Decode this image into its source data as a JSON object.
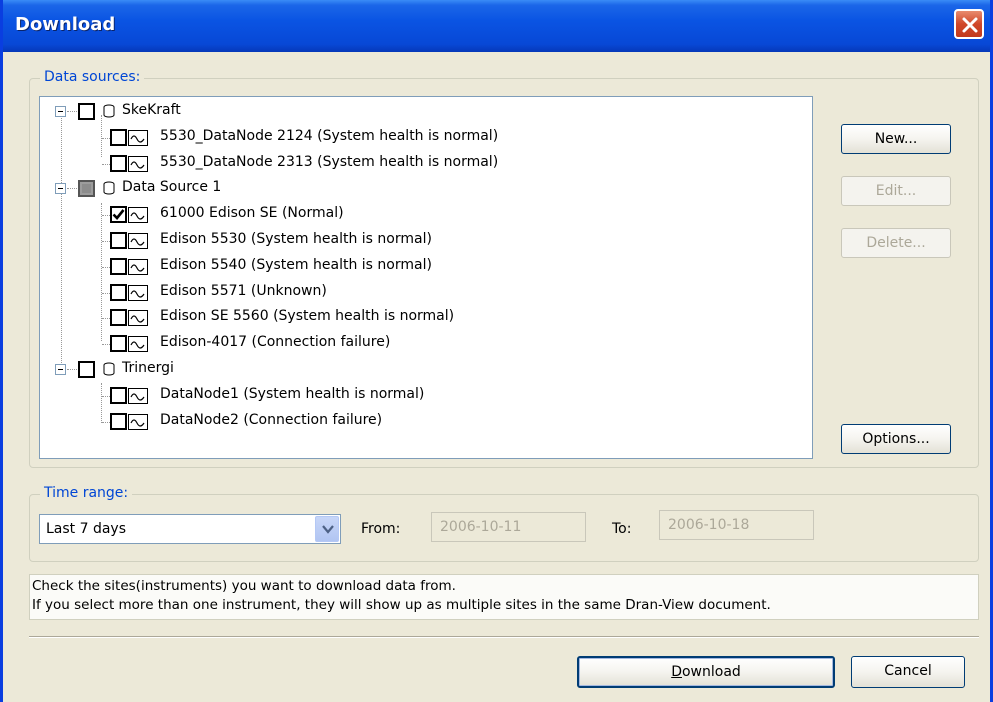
{
  "window": {
    "title": "Download",
    "close_icon": "close-icon",
    "colors": {
      "titlebar": "#0a54e3",
      "close_button": "#d0482a",
      "background": "#ece9d8"
    }
  },
  "data_sources": {
    "label": "Data sources:",
    "groups": [
      {
        "name": "SkeKraft",
        "checked": false,
        "expanded": true,
        "items": [
          {
            "label": "5530_DataNode 2124 (System health is normal)",
            "checked": false
          },
          {
            "label": "5530_DataNode 2313 (System health is normal)",
            "checked": false
          }
        ]
      },
      {
        "name": "Data Source 1",
        "checked": "partial",
        "expanded": true,
        "items": [
          {
            "label": "61000 Edison SE (Normal)",
            "checked": true
          },
          {
            "label": "Edison 5530 (System health is normal)",
            "checked": false
          },
          {
            "label": "Edison 5540 (System health is normal)",
            "checked": false
          },
          {
            "label": "Edison 5571 (Unknown)",
            "checked": false
          },
          {
            "label": "Edison SE 5560 (System health is normal)",
            "checked": false
          },
          {
            "label": "Edison-4017 (Connection failure)",
            "checked": false
          }
        ]
      },
      {
        "name": "Trinergi",
        "checked": false,
        "expanded": true,
        "items": [
          {
            "label": "DataNode1 (System health is normal)",
            "checked": false
          },
          {
            "label": "DataNode2 (Connection failure)",
            "checked": false
          }
        ]
      }
    ],
    "buttons": {
      "new": "New...",
      "edit": "Edit...",
      "delete": "Delete...",
      "options": "Options..."
    }
  },
  "time_range": {
    "label": "Time range:",
    "selected": "Last 7 days",
    "from_label": "From:",
    "from_value": "2006-10-11",
    "to_label": "To:",
    "to_value": "2006-10-18"
  },
  "info": {
    "line1": "Check the sites(instruments) you want to download data from.",
    "line2": "If you select more than one instrument, they will show up as multiple sites in the same Dran-View document."
  },
  "footer": {
    "download_mnemonic": "D",
    "download_rest": "ownload",
    "cancel": "Cancel"
  }
}
